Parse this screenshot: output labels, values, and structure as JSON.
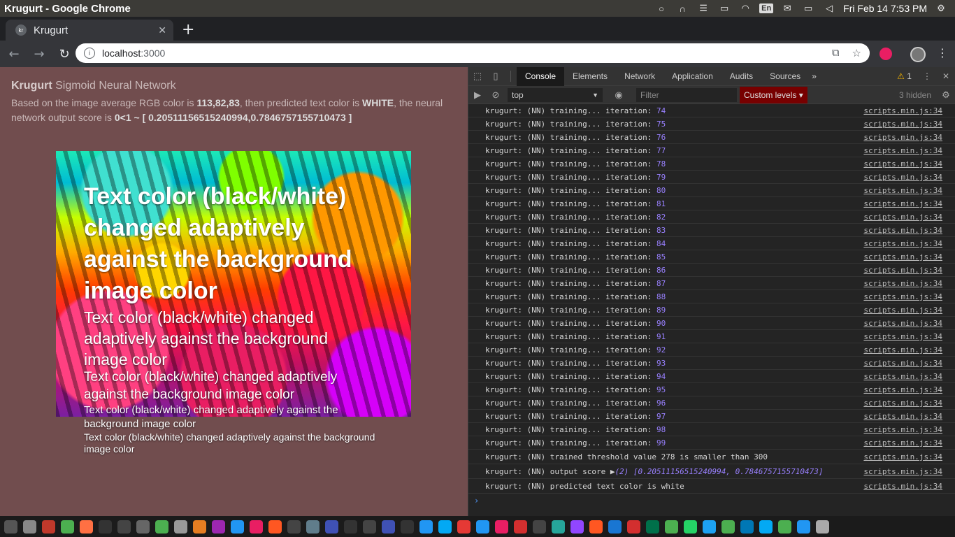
{
  "os": {
    "window_title": "Krugurt - Google Chrome",
    "lang": "En",
    "clock": "Fri Feb 14  7:53 PM"
  },
  "browser": {
    "tab_title": "Krugurt",
    "tab_favicon": "kr",
    "url_host": "localhost",
    "url_port": ":3000"
  },
  "page": {
    "brand": "Krugurt",
    "heading_rest": " Sigmoid Neural Network",
    "desc_1": "Based on the image average RGB color is ",
    "rgb": "113,82,83",
    "desc_2": ", then predicted text color is ",
    "predicted": "WHITE",
    "desc_3": ", the neural network output score is ",
    "score": "0<1 ~ [ 0.20511156515240994,0.7846757155710473 ]",
    "demo_text": "Text color (black/white) changed adaptively against the background image color"
  },
  "devtools": {
    "tabs": [
      "Console",
      "Elements",
      "Network",
      "Application",
      "Audits",
      "Sources"
    ],
    "more": "»",
    "warn_count": "1",
    "context": "top",
    "filter_placeholder": "Filter",
    "levels": "Custom levels",
    "hidden": "3 hidden",
    "log_prefix": "krugurt: (NN) training... iteration: ",
    "iterations": [
      "74",
      "75",
      "76",
      "77",
      "78",
      "79",
      "80",
      "81",
      "82",
      "83",
      "84",
      "85",
      "86",
      "87",
      "88",
      "89",
      "90",
      "91",
      "92",
      "93",
      "94",
      "95",
      "96",
      "97",
      "98",
      "99"
    ],
    "source": "scripts.min.js:34",
    "threshold_msg": "krugurt: (NN) trained threshold value 278 is smaller than 300",
    "score_prefix": "krugurt: (NN) output score ",
    "score_toggle": "▶",
    "score_len": "(2) ",
    "score_arr": "[0.20511156515240994, 0.7846757155710473]",
    "predict_msg": "krugurt: (NN) predicted text color is white",
    "prompt": "›"
  },
  "dock_colors": [
    "#555",
    "#888",
    "#c0392b",
    "#4caf50",
    "#ff7043",
    "#333",
    "#444",
    "#666",
    "#4caf50",
    "#999",
    "#e67e22",
    "#9c27b0",
    "#2196f3",
    "#e91e63",
    "#ff5722",
    "#444",
    "#607d8b",
    "#3f51b5",
    "#333",
    "#444",
    "#3f51b5",
    "#333",
    "#2196f3",
    "#03a9f4",
    "#e53935",
    "#2196f3",
    "#e91e63",
    "#d32f2f",
    "#444",
    "#26a69a",
    "#9146ff",
    "#ff5722",
    "#1976d2",
    "#d32f2f",
    "#00704a",
    "#4caf50",
    "#25d366",
    "#1da1f2",
    "#4caf50",
    "#0077b5",
    "#03a9f4",
    "#4caf50",
    "#2196f3",
    "#aaa"
  ]
}
